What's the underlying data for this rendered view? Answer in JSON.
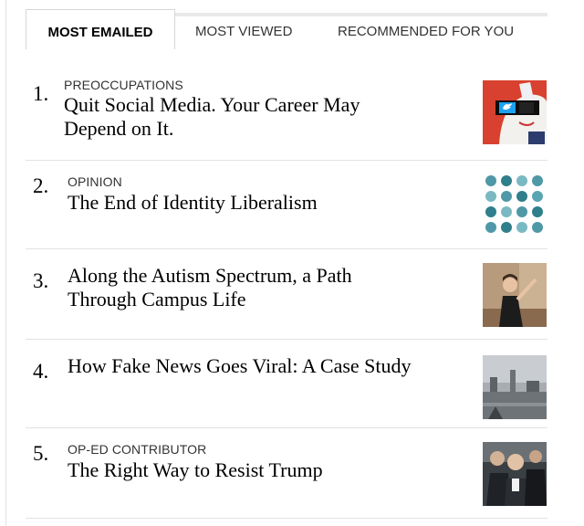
{
  "tabs": [
    {
      "label": "MOST EMAILED",
      "active": true
    },
    {
      "label": "MOST VIEWED",
      "active": false
    },
    {
      "label": "RECOMMENDED FOR YOU",
      "active": false
    }
  ],
  "articles": [
    {
      "rank": "1.",
      "kicker": "PREOCCUPATIONS",
      "headline_lines": [
        "Quit Social Media. Your Career May",
        "Depend on It."
      ],
      "thumb_icon": "twitter-mask-illustration"
    },
    {
      "rank": "2.",
      "kicker": "OPINION",
      "headline_lines": [
        "The End of Identity Liberalism"
      ],
      "thumb_icon": "heads-grid-illustration"
    },
    {
      "rank": "3.",
      "kicker": "",
      "headline_lines": [
        "Along the Autism Spectrum, a Path",
        "Through Campus Life"
      ],
      "thumb_icon": "student-photo"
    },
    {
      "rank": "4.",
      "kicker": "",
      "headline_lines": [
        "How Fake News Goes Viral: A Case Study"
      ],
      "thumb_icon": "city-street-photo"
    },
    {
      "rank": "5.",
      "kicker": "OP-ED CONTRIBUTOR",
      "headline_lines": [
        "The Right Way to Resist Trump"
      ],
      "thumb_icon": "crowd-photo"
    }
  ]
}
